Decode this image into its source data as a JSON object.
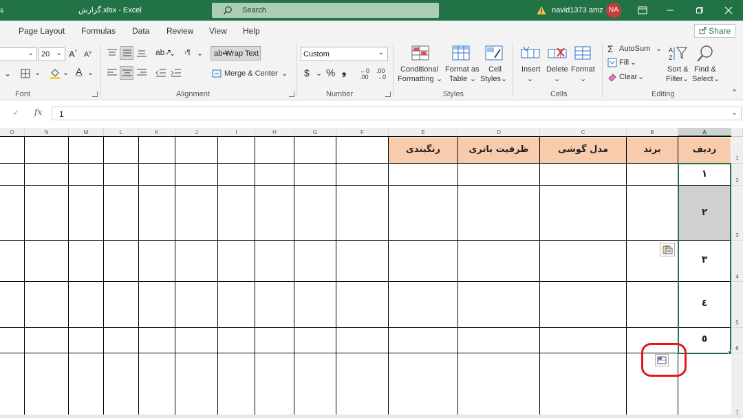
{
  "titlebar": {
    "left_glyph": "ة",
    "doc_title": "گزارش.xlsx  -  Excel",
    "search_placeholder": "Search",
    "user_name": "navid1373 amz",
    "avatar_initials": "NA",
    "colors": {
      "title_bg": "#217346",
      "search_bg": "#a9cdb5",
      "avatar_bg": "#c43e3e"
    }
  },
  "ribbon_tabs": {
    "tabs": [
      "Page Layout",
      "Formulas",
      "Data",
      "Review",
      "View",
      "Help"
    ],
    "share_label": "Share"
  },
  "ribbon": {
    "font": {
      "size_value": "20",
      "group_label": "Font"
    },
    "alignment": {
      "wrap_text_label": "Wrap Text",
      "merge_center_label": "Merge & Center",
      "group_label": "Alignment"
    },
    "number": {
      "format_value": "Custom",
      "currency_symbol": "$",
      "percent_symbol": "%",
      "comma_symbol": "❟",
      "group_label": "Number"
    },
    "styles": {
      "conditional_formatting_line1": "Conditional",
      "conditional_formatting_line2": "Formatting",
      "format_as_table_line1": "Format as",
      "format_as_table_line2": "Table",
      "cell_styles_line1": "Cell",
      "cell_styles_line2": "Styles",
      "group_label": "Styles"
    },
    "cells": {
      "insert_label": "Insert",
      "delete_label": "Delete",
      "format_label": "Format",
      "group_label": "Cells"
    },
    "editing": {
      "autosum_label": "AutoSum",
      "fill_label": "Fill",
      "clear_label": "Clear",
      "sort_filter_line1": "Sort &",
      "sort_filter_line2": "Filter",
      "find_select_line1": "Find &",
      "find_select_line2": "Select",
      "group_label": "Editing"
    }
  },
  "formula_bar": {
    "fx_label": "fx",
    "value": "1"
  },
  "sheet": {
    "columns": [
      "O",
      "N",
      "M",
      "L",
      "K",
      "J",
      "I",
      "H",
      "G",
      "F",
      "E",
      "D",
      "C",
      "B",
      "A"
    ],
    "selected_column": "A",
    "rows": [
      "1",
      "2",
      "3",
      "4",
      "5",
      "6",
      "7"
    ],
    "header_row": {
      "A": "ردیف",
      "B": "برند",
      "C": "مدل گوشی",
      "D": "ظرفیت باتری",
      "E": "رنگبندی"
    },
    "row_numbers": [
      "١",
      "٢",
      "٣",
      "٤",
      "٥"
    ],
    "colors": {
      "header_fill": "#f8cbad",
      "selection": "#217346",
      "selected_fill": "#d0d0d0"
    }
  }
}
